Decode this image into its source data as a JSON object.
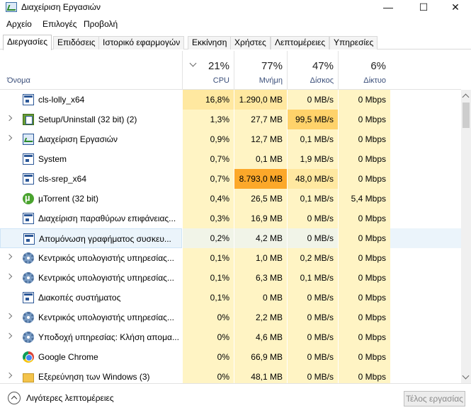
{
  "window": {
    "title": "Διαχείριση Εργασιών",
    "minimize": "—",
    "maximize": "☐",
    "close": "✕"
  },
  "menu": [
    "Αρχείο",
    "Επιλογές",
    "Προβολή"
  ],
  "tabs": [
    "Διεργασίες",
    "Επιδόσεις",
    "Ιστορικό εφαρμογών",
    "Εκκίνηση",
    "Χρήστες",
    "Λεπτομέρειες",
    "Υπηρεσίες"
  ],
  "active_tab": "Διεργασίες",
  "columns": {
    "name": "Όνομα",
    "cpu": {
      "pct": "21%",
      "label": "CPU"
    },
    "memory": {
      "pct": "77%",
      "label": "Μνήμη"
    },
    "disk": {
      "pct": "47%",
      "label": "Δίσκος"
    },
    "network": {
      "pct": "6%",
      "label": "Δίκτυο"
    }
  },
  "processes": [
    {
      "name": "cls-lolly_x64",
      "icon": "window-icon",
      "expandable": false,
      "cpu": "16,8%",
      "memory": "1.290,0 MB",
      "disk": "0 MB/s",
      "network": "0 Mbps"
    },
    {
      "name": "Setup/Uninstall (32 bit) (2)",
      "icon": "setup-icon",
      "expandable": true,
      "cpu": "1,3%",
      "memory": "27,7 MB",
      "disk": "99,5 MB/s",
      "network": "0 Mbps"
    },
    {
      "name": "Διαχείριση Εργασιών",
      "icon": "task-manager-icon",
      "expandable": true,
      "cpu": "0,9%",
      "memory": "12,7 MB",
      "disk": "0,1 MB/s",
      "network": "0 Mbps"
    },
    {
      "name": "System",
      "icon": "window-icon",
      "expandable": false,
      "cpu": "0,7%",
      "memory": "0,1 MB",
      "disk": "1,9 MB/s",
      "network": "0 Mbps"
    },
    {
      "name": "cls-srep_x64",
      "icon": "window-icon",
      "expandable": false,
      "cpu": "0,7%",
      "memory": "8.793,0 MB",
      "disk": "48,0 MB/s",
      "network": "0 Mbps"
    },
    {
      "name": "µTorrent (32 bit)",
      "icon": "utorrent-icon",
      "expandable": false,
      "cpu": "0,4%",
      "memory": "26,5 MB",
      "disk": "0,1 MB/s",
      "network": "5,4 Mbps"
    },
    {
      "name": "Διαχείριση παραθύρων επιφάνειας...",
      "icon": "window-icon",
      "expandable": false,
      "cpu": "0,3%",
      "memory": "16,9 MB",
      "disk": "0 MB/s",
      "network": "0 Mbps"
    },
    {
      "name": "Απομόνωση γραφήματος συσκευ...",
      "icon": "window-icon",
      "expandable": false,
      "cpu": "0,2%",
      "memory": "4,2 MB",
      "disk": "0 MB/s",
      "network": "0 Mbps"
    },
    {
      "name": "Κεντρικός υπολογιστής υπηρεσίας...",
      "icon": "gear-icon",
      "expandable": true,
      "cpu": "0,1%",
      "memory": "1,0 MB",
      "disk": "0,2 MB/s",
      "network": "0 Mbps"
    },
    {
      "name": "Κεντρικός υπολογιστής υπηρεσίας...",
      "icon": "gear-icon",
      "expandable": true,
      "cpu": "0,1%",
      "memory": "6,3 MB",
      "disk": "0,1 MB/s",
      "network": "0 Mbps"
    },
    {
      "name": "Διακοπές συστήματος",
      "icon": "window-icon",
      "expandable": false,
      "cpu": "0,1%",
      "memory": "0 MB",
      "disk": "0 MB/s",
      "network": "0 Mbps"
    },
    {
      "name": "Κεντρικός υπολογιστής υπηρεσίας...",
      "icon": "gear-icon",
      "expandable": true,
      "cpu": "0%",
      "memory": "2,2 MB",
      "disk": "0 MB/s",
      "network": "0 Mbps"
    },
    {
      "name": "Υποδοχή υπηρεσίας: Κλήση απομα...",
      "icon": "gear-icon",
      "expandable": true,
      "cpu": "0%",
      "memory": "4,6 MB",
      "disk": "0 MB/s",
      "network": "0 Mbps"
    },
    {
      "name": "Google Chrome",
      "icon": "chrome-icon",
      "expandable": false,
      "cpu": "0%",
      "memory": "66,9 MB",
      "disk": "0 MB/s",
      "network": "0 Mbps"
    },
    {
      "name": "Εξερεύνηση των Windows (3)",
      "icon": "folder-icon",
      "expandable": true,
      "cpu": "0%",
      "memory": "48,1 MB",
      "disk": "0 MB/s",
      "network": "0 Mbps"
    }
  ],
  "selected_row": 7,
  "colors": {
    "heat_low": "#fff4c4",
    "heat_mid": "#ffe8a0",
    "heat_high": "#ffd26a",
    "heat_max": "#fca82a",
    "selected_row": "#ebf4fb"
  },
  "footer": {
    "less_details": "Λιγότερες λεπτομέρειες",
    "end_task": "Τέλος εργασίας"
  }
}
